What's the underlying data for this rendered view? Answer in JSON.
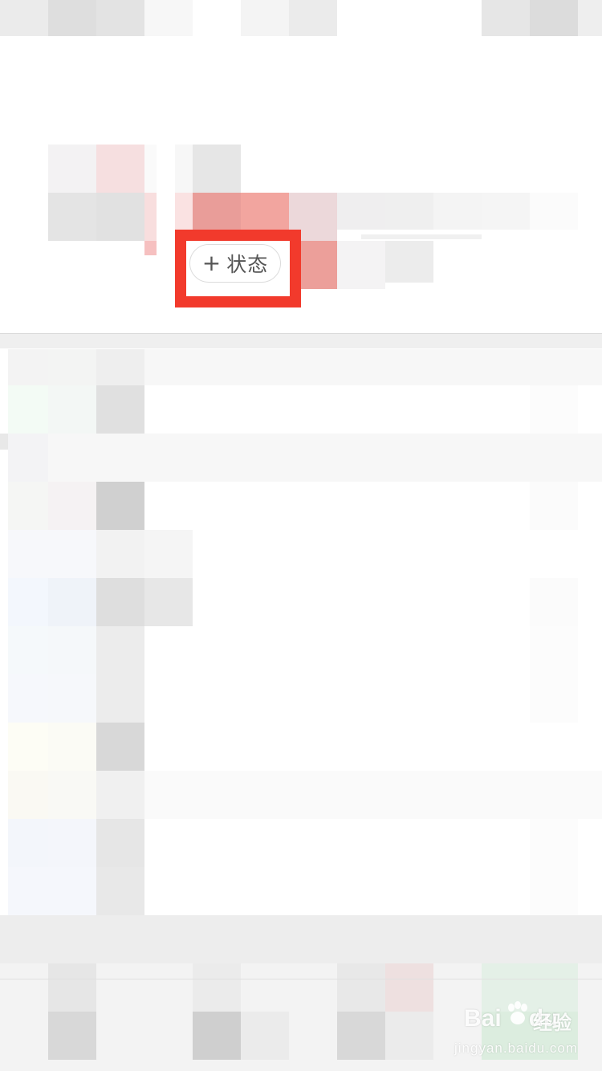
{
  "status_button": {
    "plus_symbol": "+",
    "label": "状态"
  },
  "watermark": {
    "logo_left": "Bai",
    "logo_right": "du",
    "brand_cn": "经验",
    "url": "jingyan.baidu.com"
  },
  "colors": {
    "highlight": "#f23a2c",
    "button_border": "#dcdcdc",
    "button_text": "#555555"
  }
}
